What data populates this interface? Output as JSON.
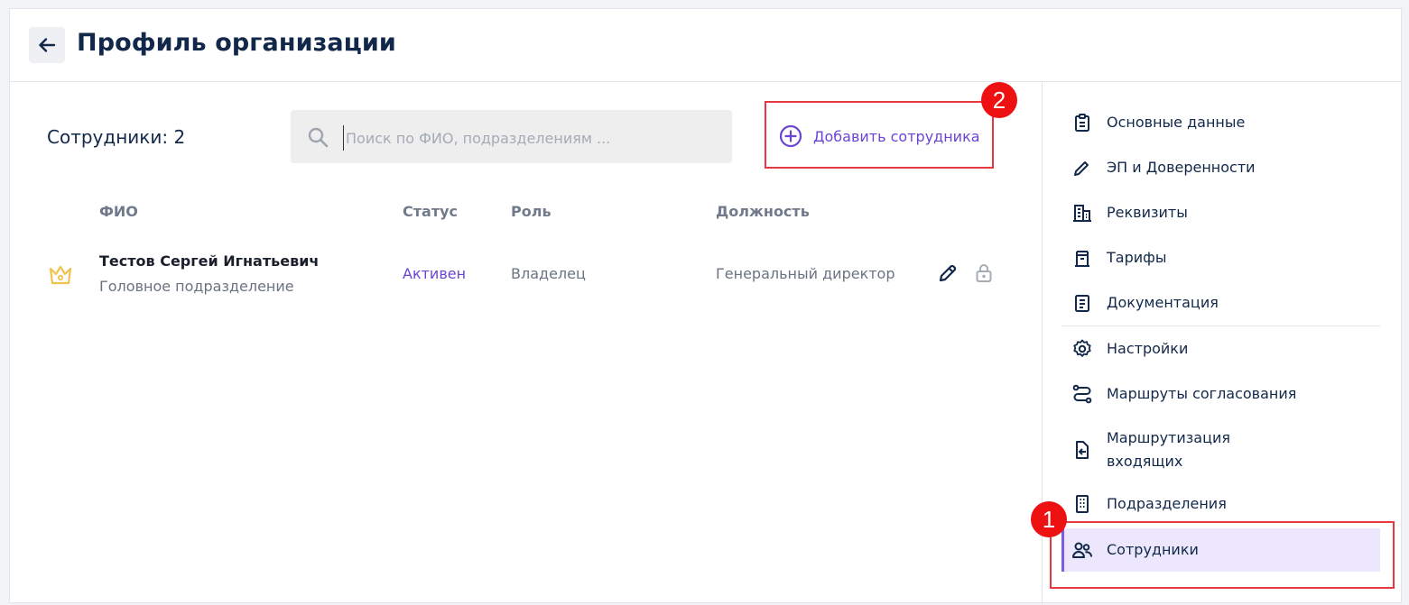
{
  "header": {
    "title": "Профиль организации"
  },
  "employees": {
    "count_label": "Сотрудники: 2",
    "search_placeholder": "Поиск по ФИО, подразделениям ...",
    "add_button_label": "Добавить сотрудника",
    "columns": [
      "ФИО",
      "Статус",
      "Роль",
      "Должность"
    ],
    "rows": [
      {
        "name": "Тестов Сергей Игнатьевич",
        "department": "Головное подразделение",
        "status": "Активен",
        "role": "Владелец",
        "position": "Генеральный директор"
      }
    ]
  },
  "sidebar": {
    "items": [
      {
        "label": "Основные данные",
        "icon": "clipboard-icon"
      },
      {
        "label": "ЭП и Доверенности",
        "icon": "pen-icon"
      },
      {
        "label": "Реквизиты",
        "icon": "building-icon"
      },
      {
        "label": "Тарифы",
        "icon": "tariff-icon"
      },
      {
        "label": "Документация",
        "icon": "document-icon"
      },
      {
        "label": "Настройки",
        "icon": "gear-icon"
      },
      {
        "label": "Маршруты согласования",
        "icon": "route-icon"
      },
      {
        "label": "Маршрутизация входящих",
        "icon": "inbox-route-icon"
      },
      {
        "label": "Подразделения",
        "icon": "office-icon"
      },
      {
        "label": "Сотрудники",
        "icon": "users-icon",
        "active": true
      }
    ]
  },
  "annotations": {
    "badge_1": "1",
    "badge_2": "2"
  },
  "colors": {
    "accent": "#6a44d4",
    "highlight": "#e5393f",
    "badge": "#ee1111",
    "owner_crown": "#f2c14e"
  }
}
